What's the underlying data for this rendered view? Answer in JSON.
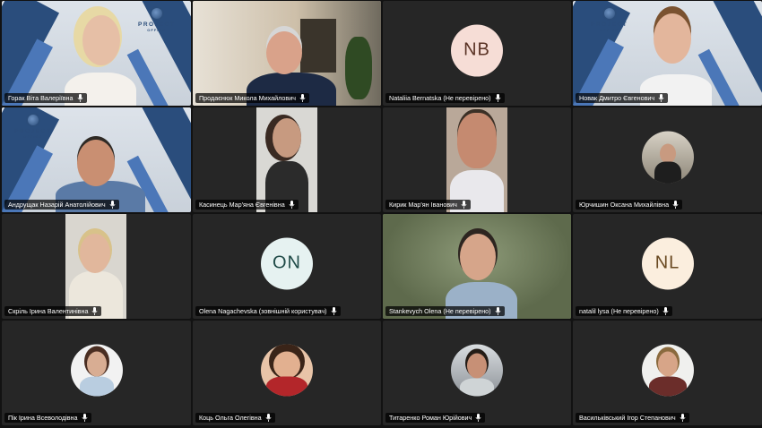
{
  "participants": [
    {
      "name": "Горак Віта Валеріївна"
    },
    {
      "name": "Продаєнюк Микола Михайлович"
    },
    {
      "name": "Nataliia Bernatska (Не перевірено)",
      "initials": "NB",
      "avatar_bg": "#f6ddd6",
      "avatar_fg": "#5a3325"
    },
    {
      "name": "Новак Дмитро Євгенович"
    },
    {
      "name": "Андрущак Назарій Анатолійович"
    },
    {
      "name": "Касинець Мар'яна Євгенівна"
    },
    {
      "name": "Кирик Мар'ян Іванович"
    },
    {
      "name": "Юрчишин Оксана Михайлівна"
    },
    {
      "name": "Скрiль Ірина Валентинівна"
    },
    {
      "name": "Olena Nagachevska (зовнішній користувач)",
      "initials": "ON",
      "avatar_bg": "#e6f2f1",
      "avatar_fg": "#1f4a47"
    },
    {
      "name": "Stankevych Olena (Не перевірено)"
    },
    {
      "name": "natalil lysa (Не перевірено)",
      "initials": "NL",
      "avatar_bg": "#fbeede",
      "avatar_fg": "#6a4a22"
    },
    {
      "name": "Пік Ірина Всеволодівна"
    },
    {
      "name": "Коць Ольга Олегівна"
    },
    {
      "name": "Титаренко Роман Юрійович"
    },
    {
      "name": "Васильківський Ігор Степанович"
    }
  ],
  "office_logo": {
    "title": "PROJECT",
    "subtitle": "OFFICE"
  },
  "colors": {
    "active_outline": "#8a8fe6",
    "label_bg": "rgba(0,0,0,0.72)"
  },
  "icons": {
    "mic": "mic-icon"
  }
}
